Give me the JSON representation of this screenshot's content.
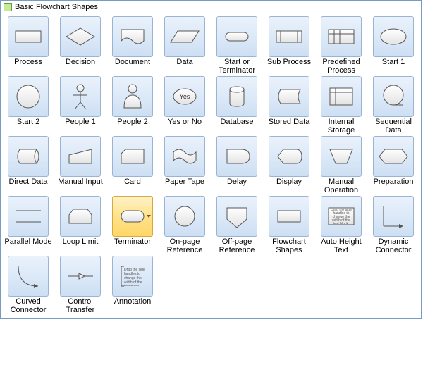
{
  "panel": {
    "title": "Basic Flowchart Shapes"
  },
  "shapes": [
    {
      "id": "process",
      "label": "Process"
    },
    {
      "id": "decision",
      "label": "Decision"
    },
    {
      "id": "document",
      "label": "Document"
    },
    {
      "id": "data",
      "label": "Data"
    },
    {
      "id": "start_term",
      "label": "Start or Terminator"
    },
    {
      "id": "sub_process",
      "label": "Sub Process"
    },
    {
      "id": "predef_process",
      "label": "Predefined Process"
    },
    {
      "id": "start1",
      "label": "Start 1"
    },
    {
      "id": "start2",
      "label": "Start 2"
    },
    {
      "id": "people1",
      "label": "People 1"
    },
    {
      "id": "people2",
      "label": "People 2"
    },
    {
      "id": "yes_no",
      "label": "Yes or No",
      "text": "Yes"
    },
    {
      "id": "database",
      "label": "Database"
    },
    {
      "id": "stored_data",
      "label": "Stored Data"
    },
    {
      "id": "int_storage",
      "label": "Internal Storage"
    },
    {
      "id": "seq_data",
      "label": "Sequential Data"
    },
    {
      "id": "direct_data",
      "label": "Direct Data"
    },
    {
      "id": "manual_input",
      "label": "Manual Input"
    },
    {
      "id": "card",
      "label": "Card"
    },
    {
      "id": "paper_tape",
      "label": "Paper Tape"
    },
    {
      "id": "delay",
      "label": "Delay"
    },
    {
      "id": "display",
      "label": "Display"
    },
    {
      "id": "manual_op",
      "label": "Manual Operation"
    },
    {
      "id": "preparation",
      "label": "Preparation"
    },
    {
      "id": "parallel_mode",
      "label": "Parallel Mode"
    },
    {
      "id": "loop_limit",
      "label": "Loop Limit"
    },
    {
      "id": "terminator",
      "label": "Terminator",
      "selected": true
    },
    {
      "id": "onpage_ref",
      "label": "On-page Reference"
    },
    {
      "id": "offpage_ref",
      "label": "Off-page Reference"
    },
    {
      "id": "flow_shapes",
      "label": "Flowchart Shapes"
    },
    {
      "id": "auto_height",
      "label": "Auto Height Text",
      "text": "Drag the side handles to change the width of the text block."
    },
    {
      "id": "dyn_connector",
      "label": "Dynamic Connector"
    },
    {
      "id": "curved_conn",
      "label": "Curved Connector"
    },
    {
      "id": "ctrl_transfer",
      "label": "Control Transfer"
    },
    {
      "id": "annotation",
      "label": "Annotation",
      "text": "Drag the side handles to change the width of the text block."
    }
  ]
}
